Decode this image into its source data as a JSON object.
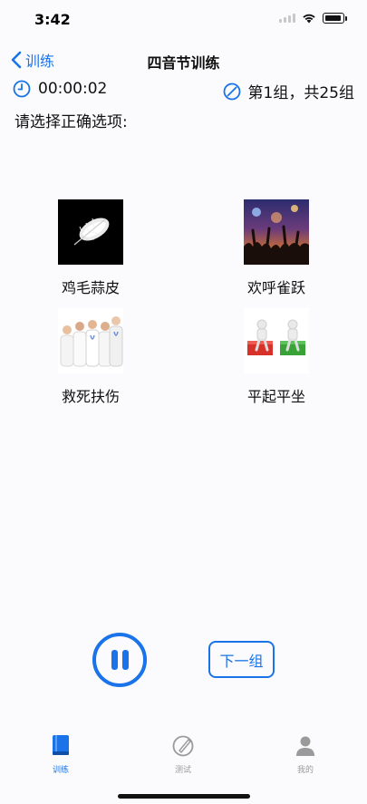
{
  "status_bar": {
    "time": "3:42"
  },
  "nav": {
    "back_label": "训练",
    "title": "四音节训练"
  },
  "info": {
    "timer": "00:00:02",
    "group": "第1组，共25组"
  },
  "prompt": "请选择正确选项:",
  "options": [
    {
      "label": "鸡毛蒜皮",
      "image": "feather-image"
    },
    {
      "label": "欢呼雀跃",
      "image": "concert-crowd-image"
    },
    {
      "label": "救死扶伤",
      "image": "doctors-group-image"
    },
    {
      "label": "平起平坐",
      "image": "figures-on-blocks-image"
    }
  ],
  "controls": {
    "next_label": "下一组",
    "pause_icon": "pause-icon"
  },
  "tabs": [
    {
      "label": "训练",
      "icon": "book-icon",
      "active": true
    },
    {
      "label": "测试",
      "icon": "test-icon",
      "active": false
    },
    {
      "label": "我的",
      "icon": "person-icon",
      "active": false
    }
  ],
  "colors": {
    "accent": "#1a73e8",
    "tab_inactive": "#9a9a9a"
  }
}
